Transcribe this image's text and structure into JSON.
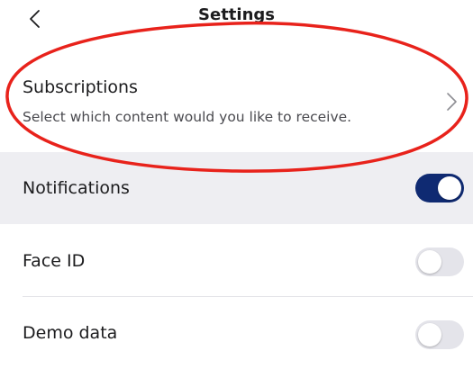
{
  "header": {
    "title": "Settings",
    "back_icon": "chevron-left-icon"
  },
  "subscriptions": {
    "title": "Subscriptions",
    "description": "Select which content would you like to receive.",
    "chevron_icon": "chevron-right-icon"
  },
  "settings": [
    {
      "label": "Notifications",
      "enabled": true
    },
    {
      "label": "Face ID",
      "enabled": false
    },
    {
      "label": "Demo data",
      "enabled": false
    }
  ],
  "colors": {
    "toggle_on": "#0f2a72",
    "toggle_off": "#e4e4ea",
    "highlight_row": "#eeeef2",
    "annotation": "#e8221b"
  }
}
